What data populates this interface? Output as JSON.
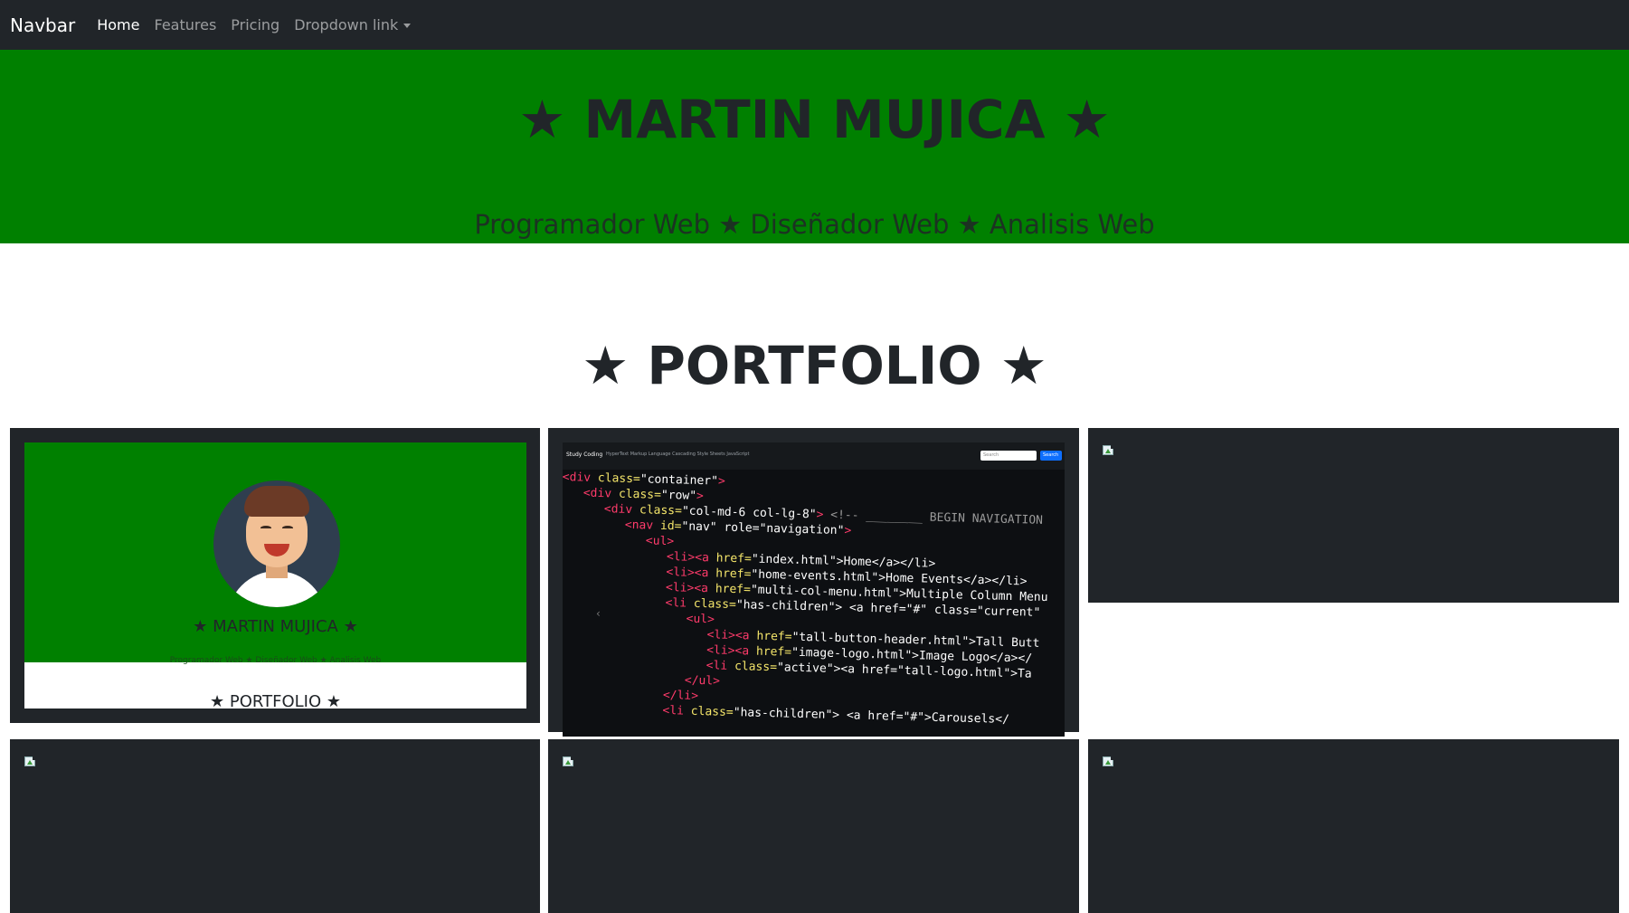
{
  "navbar": {
    "brand": "Navbar",
    "links": [
      {
        "label": "Home",
        "active": true
      },
      {
        "label": "Features",
        "active": false
      },
      {
        "label": "Pricing",
        "active": false
      },
      {
        "label": "Dropdown link",
        "active": false,
        "dropdown": true
      }
    ]
  },
  "hero": {
    "title": "★ MARTIN MUJICA ★",
    "subtitle": "Programador Web ★ Diseñador Web ★ Analisis Web",
    "background": "#008000"
  },
  "portfolio": {
    "title": "★ PORTFOLIO ★",
    "card_background": "#212529",
    "cards": [
      {
        "kind": "site-preview",
        "preview_name": "★ MARTIN MUJICA ★",
        "preview_subtitle": "Programador Web ★ Diseñador Web ★ Analisis Web",
        "preview_portfolio": "★ PORTFOLIO ★"
      },
      {
        "kind": "code-preview",
        "nav_brand": "Study Coding",
        "nav_links": "HyperText Markup Language    Cascading Style Sheets    JavaScript",
        "search_placeholder": "Search",
        "search_button": "Search",
        "code_lines": [
          {
            "indent": "",
            "tag": "<div",
            "attr": " class=",
            "str": "\"container\"",
            "end": ">"
          },
          {
            "indent": "   ",
            "tag": "<div",
            "attr": " class=",
            "str": "\"row\"",
            "end": ">"
          },
          {
            "indent": "      ",
            "tag": "<div",
            "attr": " class=",
            "str": "\"col-md-6 col-lg-8\"",
            "end": "> ",
            "comment": "<!-- ________ BEGIN NAVIGATION"
          },
          {
            "indent": "         ",
            "tag": "<nav",
            "attr": " id=",
            "str": "\"nav\" role=\"navigation\"",
            "end": ">"
          },
          {
            "indent": "            ",
            "tag": "<ul",
            "attr": "",
            "str": "",
            "end": ">"
          },
          {
            "indent": "               ",
            "tag": "<li><a",
            "attr": " href=",
            "str": "\"index.html\">Home</a></li>",
            "end": ""
          },
          {
            "indent": "               ",
            "tag": "<li><a",
            "attr": " href=",
            "str": "\"home-events.html\">Home Events</a></li>",
            "end": ""
          },
          {
            "indent": "               ",
            "tag": "<li><a",
            "attr": " href=",
            "str": "\"multi-col-menu.html\">Multiple Column Menu",
            "end": ""
          },
          {
            "indent": "               ",
            "tag": "<li",
            "attr": " class=",
            "str": "\"has-children\"> <a href=\"#\" class=\"current\"",
            "end": ""
          },
          {
            "indent": "                  ",
            "tag": "<ul",
            "attr": "",
            "str": "",
            "end": ">"
          },
          {
            "indent": "                     ",
            "tag": "<li><a",
            "attr": " href=",
            "str": "\"tall-button-header.html\">Tall Butt",
            "end": ""
          },
          {
            "indent": "                     ",
            "tag": "<li><a",
            "attr": " href=",
            "str": "\"image-logo.html\">Image Logo</a></",
            "end": ""
          },
          {
            "indent": "                     ",
            "tag": "<li",
            "attr": " class=",
            "str": "\"active\"><a href=\"tall-logo.html\">Ta",
            "end": ""
          },
          {
            "indent": "                  ",
            "tag": "</ul>",
            "attr": "",
            "str": "",
            "end": ""
          },
          {
            "indent": "               ",
            "tag": "</li>",
            "attr": "",
            "str": "",
            "end": ""
          },
          {
            "indent": "               ",
            "tag": "<li",
            "attr": " class=",
            "str": "\"has-children\"> <a href=\"#\">Carousels</",
            "end": ""
          }
        ]
      },
      {
        "kind": "broken-image",
        "icon": "broken-image-icon"
      },
      {
        "kind": "broken-image",
        "icon": "broken-image-icon"
      },
      {
        "kind": "broken-image",
        "icon": "broken-image-icon"
      },
      {
        "kind": "broken-image",
        "icon": "broken-image-icon"
      }
    ]
  }
}
